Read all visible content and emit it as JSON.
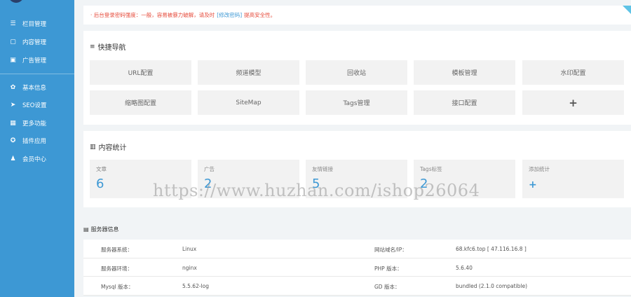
{
  "sidebar": {
    "items": [
      {
        "icon": "list-icon",
        "glyph": "☰",
        "label": "栏目管理"
      },
      {
        "icon": "document-icon",
        "glyph": "▢",
        "label": "内容管理"
      },
      {
        "icon": "image-icon",
        "glyph": "▣",
        "label": "广告管理"
      },
      {
        "icon": "gear-icon",
        "glyph": "✿",
        "label": "基本信息"
      },
      {
        "icon": "send-icon",
        "glyph": "➤",
        "label": "SEO设置"
      },
      {
        "icon": "grid-icon",
        "glyph": "▦",
        "label": "更多功能"
      },
      {
        "icon": "plugin-icon",
        "glyph": "✪",
        "label": "插件应用"
      },
      {
        "icon": "user-icon",
        "glyph": "♟",
        "label": "会员中心"
      }
    ]
  },
  "notice": {
    "prefix": "· 后台登录密码强度：一般，容易被暴力破解，请及时",
    "link": "[修改密码]",
    "suffix": "提高安全性。"
  },
  "quick_nav": {
    "title": "快捷导航",
    "icon": "menu-icon",
    "items": [
      "URL配置",
      "频道模型",
      "回收站",
      "模板管理",
      "水印配置",
      "缩略图配置",
      "SiteMap",
      "Tags管理",
      "接口配置",
      "+"
    ]
  },
  "stats": {
    "title": "内容统计",
    "icon": "bar-chart-icon",
    "items": [
      {
        "label": "文章",
        "value": "6"
      },
      {
        "label": "广告",
        "value": "2"
      },
      {
        "label": "友情链接",
        "value": "5"
      },
      {
        "label": "Tags标签",
        "value": "2"
      },
      {
        "label": "添加统计",
        "value": "+"
      }
    ]
  },
  "watermark": "https://www.huzhan.com/ishop26064",
  "server": {
    "title": "服务器信息",
    "icon": "server-icon",
    "rows": [
      [
        "服务器系统：",
        "Linux",
        "网站域名/IP：",
        "68.kfc6.top [ 47.116.16.8 ]"
      ],
      [
        "服务器环境：",
        "nginx",
        "PHP 版本：",
        "5.6.40"
      ],
      [
        "Mysql 版本：",
        "5.5.62-log",
        "GD 版本：",
        "bundled (2.1.0 compatible)"
      ]
    ]
  },
  "colors": {
    "sidebar": "#3d98d4",
    "accent": "#3d98d4",
    "warning": "#e64b3b"
  }
}
